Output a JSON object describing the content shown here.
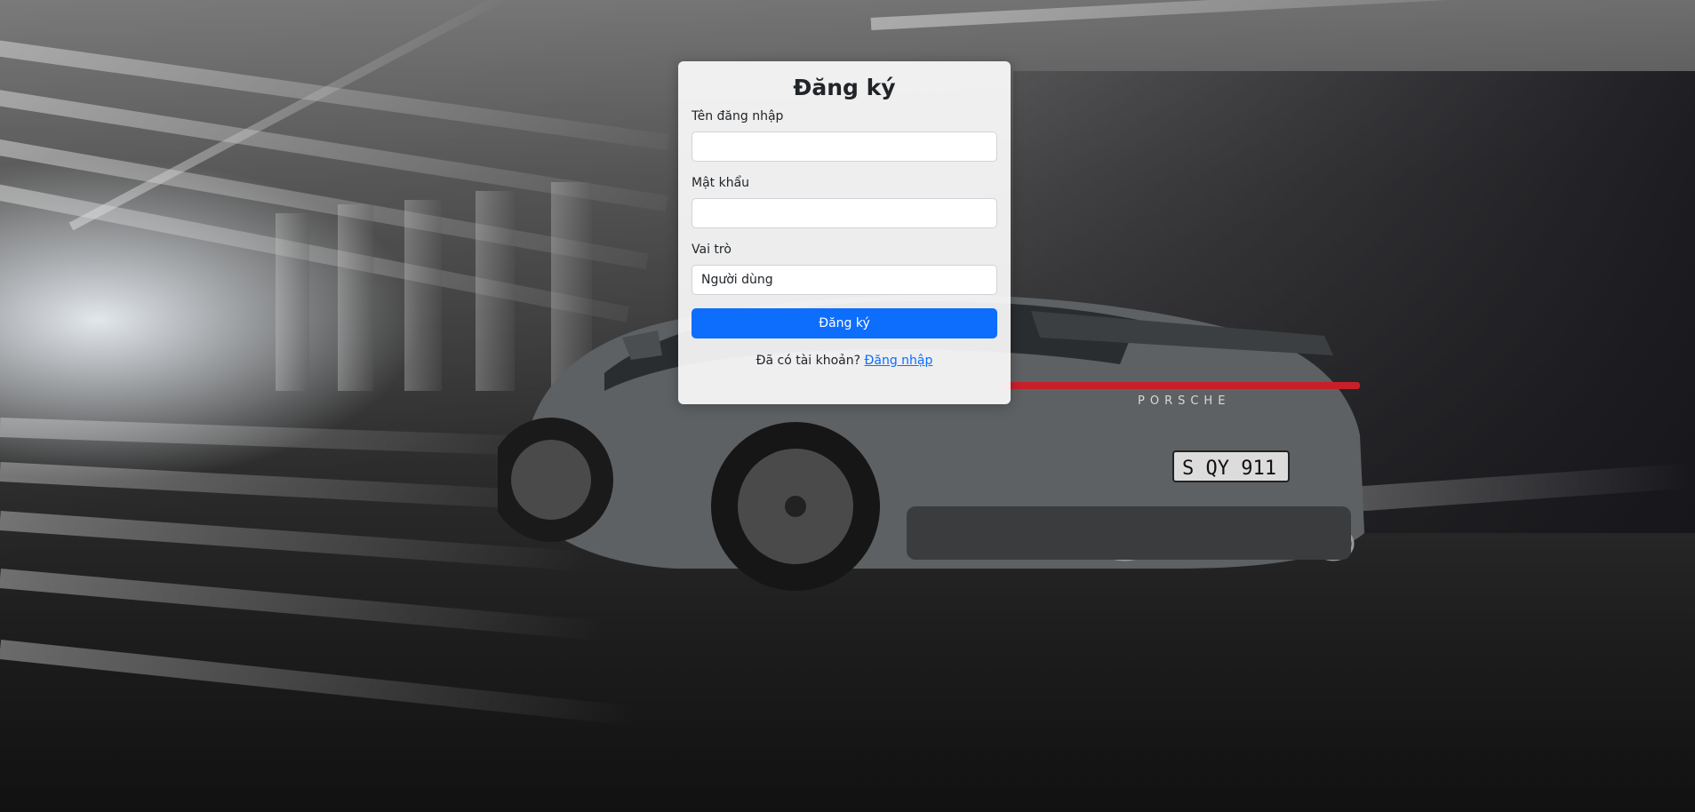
{
  "form": {
    "title": "Đăng ký",
    "username_label": "Tên đăng nhập",
    "username_value": "",
    "password_label": "Mật khẩu",
    "password_value": "",
    "role_label": "Vai trò",
    "role_selected": "Người dùng",
    "submit_label": "Đăng ký",
    "has_account_text": "Đã có tài khoản?",
    "login_link": "Đăng nhập"
  },
  "background": {
    "license_plate": "S QY 911",
    "car_brand": "PORSCHE"
  },
  "colors": {
    "primary": "#0d6efd",
    "card_bg": "#ffffff"
  }
}
